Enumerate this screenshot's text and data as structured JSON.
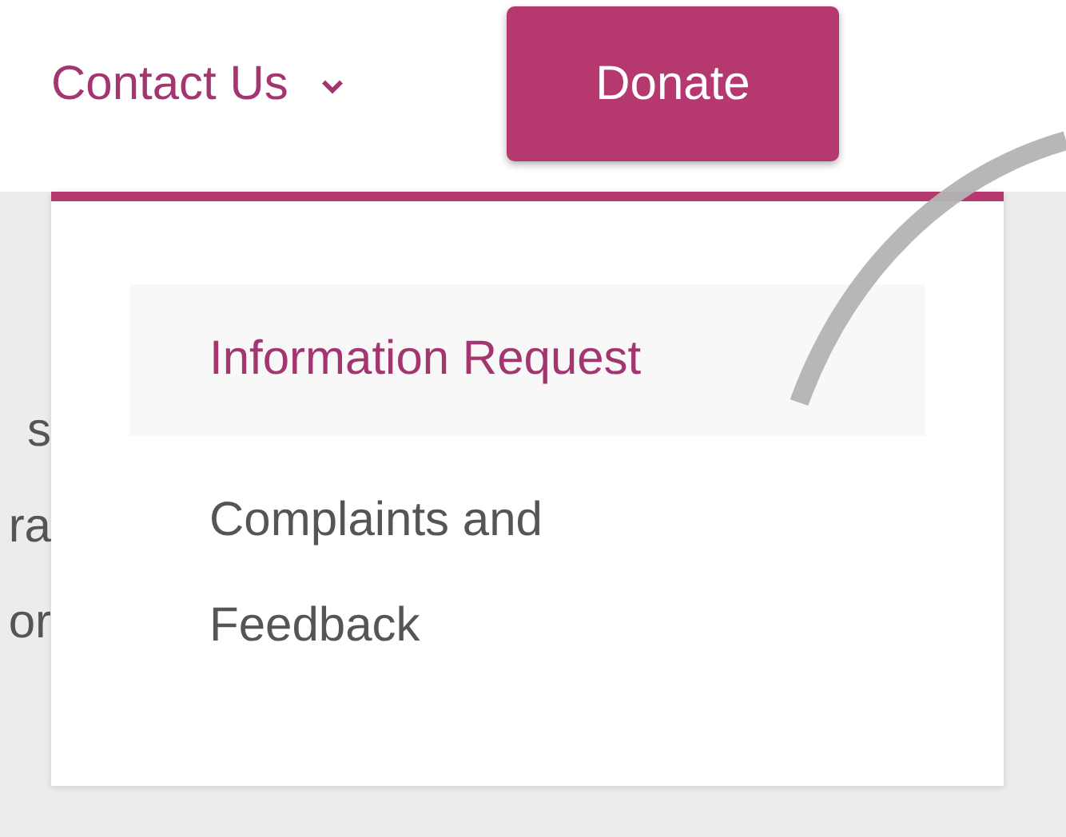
{
  "nav": {
    "label": "Contact Us",
    "expanded": true
  },
  "donate_button": {
    "label": "Donate"
  },
  "background_text": [
    "s",
    "ra",
    "or"
  ],
  "dropdown": {
    "items": [
      {
        "label": "Information Request",
        "selected": true
      },
      {
        "label": "Complaints and Feedback",
        "selected": false
      }
    ]
  }
}
